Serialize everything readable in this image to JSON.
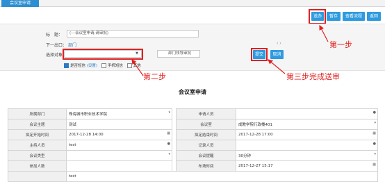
{
  "tab": {
    "label": "会议室申请"
  },
  "toolbar": {
    "send": "送办",
    "save": "暂存",
    "flow": "查看流程",
    "back": "返回"
  },
  "form": {
    "title_label": "标　题：",
    "title_value": "(---会议室申请,请审批)",
    "next_step_label": "下一出口：",
    "next_step_value": "部门",
    "select_label": "选择对象：",
    "target_value": "部门领导审批",
    "submit": "提交",
    "cancel": "取消",
    "check_sms": "是否短信",
    "check_sms_link": "(设置)",
    "check_phone": "手机短信",
    "check_other": "其他"
  },
  "annotations": {
    "step1": "第一步",
    "step2": "第二步",
    "step3": "第三步完成送审"
  },
  "doc_title": "会议室申请",
  "table": [
    {
      "l1": "所属部门",
      "v1": "珠海城市职业技术学院",
      "l2": "申请人员",
      "v2": ""
    },
    {
      "l1": "会议主题",
      "v1": "测试",
      "l2": "会议室",
      "v2": "成教学院行政楼401"
    },
    {
      "l1": "拟定开始时间",
      "v1": "2017-12-28 14:00",
      "l2": "拟定结束时间",
      "v2": "2017-12-28 17:00"
    },
    {
      "l1": "主持人员",
      "v1": "test",
      "l2": "记录人员",
      "v2": ""
    },
    {
      "l1": "会议类型",
      "v1": "",
      "l2": "会议提醒",
      "v2": "30分钟"
    },
    {
      "l1": "参加人数",
      "v1": "",
      "l2": "布场时间",
      "v2": "2017-12-27 15:17"
    },
    {
      "l1": "",
      "v1": "test",
      "l2": "",
      "v2": ""
    }
  ]
}
